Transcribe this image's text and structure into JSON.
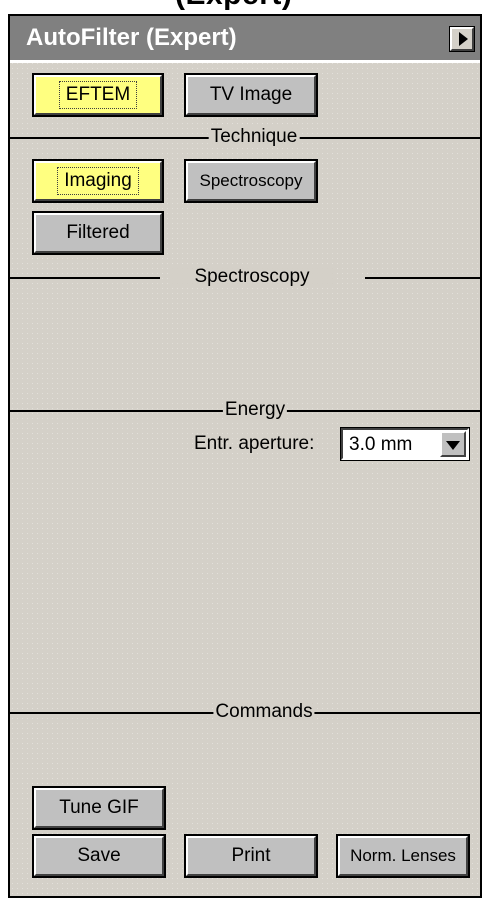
{
  "top_clip_text": "(Expert)",
  "window": {
    "title": "AutoFilter (Expert)",
    "menu_icon": "triangle-right-icon"
  },
  "mode_buttons": {
    "eftem": "EFTEM",
    "tv_image": "TV Image",
    "active": "EFTEM"
  },
  "sections": {
    "technique": "Technique",
    "spectroscopy": "Spectroscopy",
    "energy": "Energy",
    "commands": "Commands"
  },
  "technique_buttons": {
    "imaging": "Imaging",
    "spectroscopy": "Spectroscopy",
    "filtered": "Filtered",
    "active": "Imaging"
  },
  "energy": {
    "aperture_label": "Entr. aperture:",
    "aperture_value": "3.0 mm",
    "dropdown_icon": "triangle-down-icon"
  },
  "commands": {
    "tune_gif": "Tune GIF",
    "save": "Save",
    "print": "Print",
    "norm_lenses": "Norm. Lenses"
  },
  "colors": {
    "panel_bg": "#d4d0c8",
    "titlebar_bg": "#808080",
    "active_button": "#ffff80",
    "button_bg": "#c0c0c0"
  }
}
